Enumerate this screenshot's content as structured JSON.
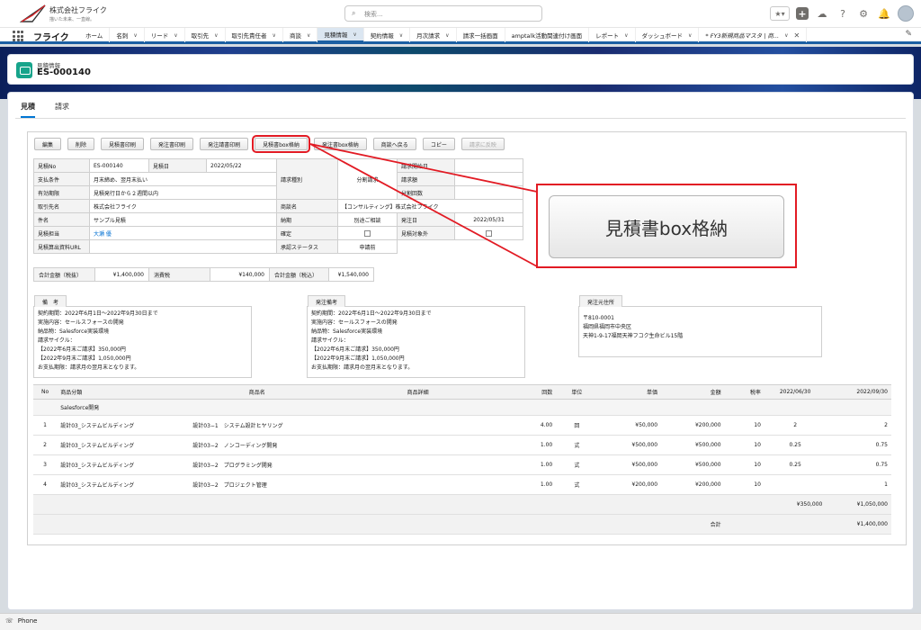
{
  "header": {
    "company": "株式会社フライク",
    "tagline": "描いた未来、一直線。",
    "search_placeholder": "検索..."
  },
  "nav": {
    "app_name": "フライク",
    "items": [
      {
        "label": "ホーム",
        "chevron": false,
        "active": false
      },
      {
        "label": "名刺",
        "chevron": true,
        "active": false
      },
      {
        "label": "リード",
        "chevron": true,
        "active": false
      },
      {
        "label": "取引先",
        "chevron": true,
        "active": false
      },
      {
        "label": "取引先責任者",
        "chevron": true,
        "active": false
      },
      {
        "label": "商談",
        "chevron": true,
        "active": false
      },
      {
        "label": "見積情報",
        "chevron": true,
        "active": true
      },
      {
        "label": "契約情報",
        "chevron": true,
        "active": false
      },
      {
        "label": "月次請求",
        "chevron": true,
        "active": false
      },
      {
        "label": "請求一括画面",
        "chevron": false,
        "active": false
      },
      {
        "label": "amptalk活動関連付け画面",
        "chevron": false,
        "active": false
      },
      {
        "label": "レポート",
        "chevron": true,
        "active": false
      },
      {
        "label": "ダッシュボード",
        "chevron": true,
        "active": false
      },
      {
        "label": "* FY3新規商品マスタ | 商...",
        "chevron": true,
        "active": false,
        "italic": true,
        "closable": true
      }
    ]
  },
  "record": {
    "object_label": "見積情報",
    "name": "ES-000140"
  },
  "tabs": [
    {
      "label": "見積",
      "active": true
    },
    {
      "label": "請求",
      "active": false
    }
  ],
  "buttons": [
    {
      "label": "編集",
      "state": "normal"
    },
    {
      "label": "削除",
      "state": "normal"
    },
    {
      "label": "見積書印刷",
      "state": "normal"
    },
    {
      "label": "発注書印刷",
      "state": "normal"
    },
    {
      "label": "発注請書印刷",
      "state": "normal"
    },
    {
      "label": "見積書box格納",
      "state": "highlighted"
    },
    {
      "label": "発注書box格納",
      "state": "normal"
    },
    {
      "label": "商談へ戻る",
      "state": "normal"
    },
    {
      "label": "コピー",
      "state": "normal"
    },
    {
      "label": "請求に反映",
      "state": "disabled"
    }
  ],
  "details": {
    "quote_no_label": "見積No",
    "quote_no": "ES-000140",
    "quote_date_label": "見積日",
    "quote_date": "2022/05/22",
    "payment_label": "支払条件",
    "payment": "月末締め、翌月末払い",
    "validity_label": "有効期限",
    "validity": "見積発行日から２週間以内",
    "billing_type_label": "請求種別",
    "billing_type": "分割請求",
    "billing_start_label": "請求開始日",
    "billing_start": "",
    "billing_amount_label": "請求額",
    "billing_amount": "",
    "split_count_label": "分割回数",
    "split_count": "",
    "account_label": "取引先名",
    "account": "株式会社フライク",
    "opportunity_label": "商談名",
    "opportunity": "【コンサルティング】株式会社フライク",
    "subject_label": "件名",
    "subject": "サンプル見積",
    "delivery_label": "納期",
    "delivery": "別途ご相談",
    "order_date_label": "発注日",
    "order_date": "2022/05/31",
    "owner_label": "見積担当",
    "owner": "大瀬 優",
    "confirmed_label": "確定",
    "confirmed": false,
    "excluded_label": "見積対象外",
    "excluded": false,
    "source_url_label": "見積算出資料URL",
    "source_url": "",
    "approval_label": "承認ステータス",
    "approval": "申請前"
  },
  "amounts": {
    "subtotal_label": "合計金額（税抜）",
    "subtotal": "¥1,400,000",
    "tax_label": "消費税",
    "tax": "¥140,000",
    "total_label": "合計金額（税込）",
    "total": "¥1,540,000"
  },
  "remarks": {
    "label": "備　考",
    "lines": [
      "契約期間：2022年6月1日〜2022年9月30日まで",
      "実施内容：セールスフォースの開発",
      "納品物：Salesforce実装環境",
      "請求サイクル：",
      "【2022年6月末ご請求】350,000円",
      "【2022年9月末ご請求】1,050,000円",
      "お支払期限：請求月の翌月末となります。"
    ]
  },
  "order_remarks": {
    "label": "発注備考",
    "lines": [
      "契約期間：2022年6月1日〜2022年9月30日まで",
      "実施内容：セールスフォースの開発",
      "納品物：Salesforce実装環境",
      "請求サイクル：",
      "【2022年6月末ご請求】350,000円",
      "【2022年9月末ご請求】1,050,000円",
      "お支払期限：請求月の翌月末となります。"
    ]
  },
  "order_address": {
    "label": "発注元住所",
    "lines": [
      "〒810-0001",
      "福岡県福岡市中央区",
      "天神1-9-17福岡天神フコク生命ビル15階"
    ]
  },
  "line_items": {
    "headers": [
      "No",
      "商品分類",
      "商品名",
      "商品詳細",
      "回数",
      "単位",
      "単価",
      "金額",
      "税率",
      "2022/06/30",
      "2022/09/30"
    ],
    "category": "Salesforce開発",
    "rows": [
      [
        "1",
        "設計03_システムビルディング",
        "設計03−1　システム設計ヒヤリング",
        "",
        "4.00",
        "回",
        "¥50,000",
        "¥200,000",
        "10",
        "2",
        "2"
      ],
      [
        "2",
        "設計03_システムビルディング",
        "設計03−2　ノンコーディング開発",
        "",
        "1.00",
        "式",
        "¥500,000",
        "¥500,000",
        "10",
        "0.25",
        "0.75"
      ],
      [
        "3",
        "設計03_システムビルディング",
        "設計03−2　プログラミング開発",
        "",
        "1.00",
        "式",
        "¥500,000",
        "¥500,000",
        "10",
        "0.25",
        "0.75"
      ],
      [
        "4",
        "設計03_システムビルディング",
        "設計03−2　プロジェクト管理",
        "",
        "1.00",
        "式",
        "¥200,000",
        "¥200,000",
        "10",
        "",
        "1"
      ]
    ],
    "subtotals": [
      "¥350,000",
      "¥1,050,000"
    ],
    "total_label": "合計",
    "total": "¥1,400,000"
  },
  "callout": {
    "zoom_label": "見積書box格納",
    "color": "#e21b24"
  },
  "utility": {
    "phone_label": "Phone"
  }
}
